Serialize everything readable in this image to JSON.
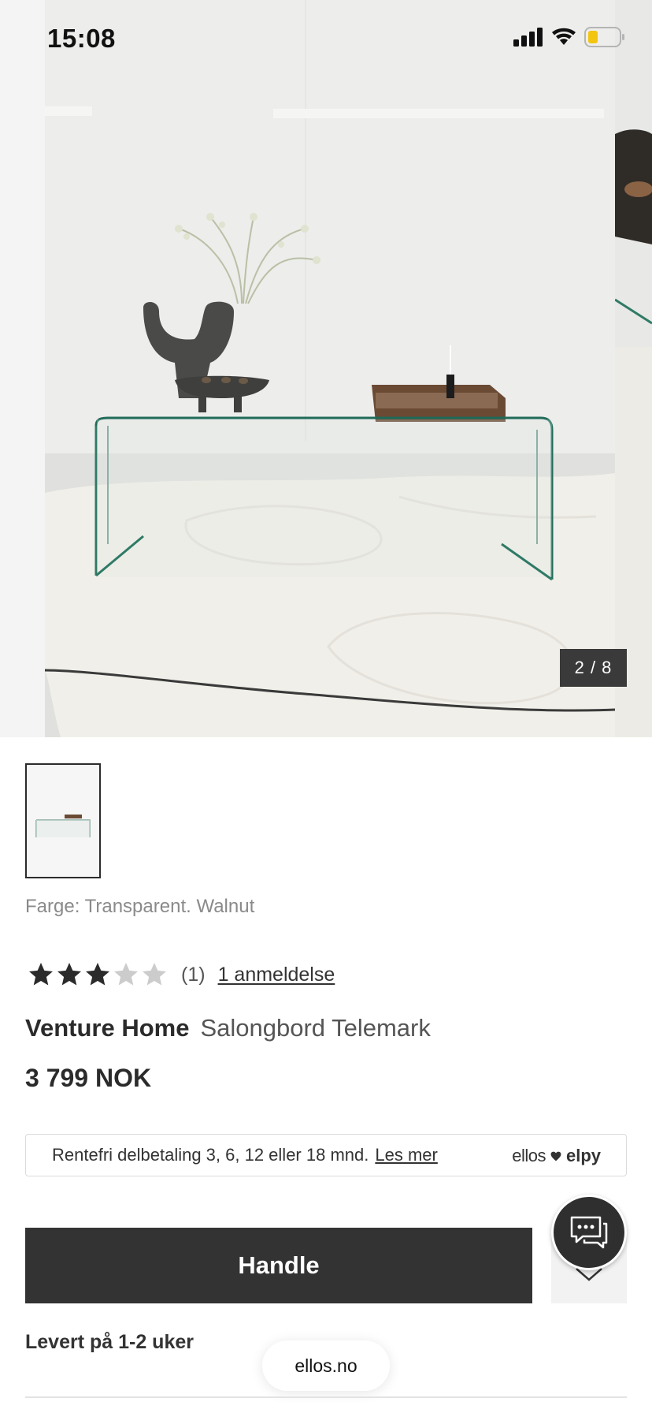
{
  "status_bar": {
    "time": "15:08",
    "icons": [
      "signal-icon",
      "wifi-icon",
      "battery-icon"
    ]
  },
  "gallery": {
    "counter": "2 / 8",
    "thumbnail_alt": "glass-coffee-table-thumbnail"
  },
  "product": {
    "color_line": "Farge: Transparent. Walnut",
    "rating": {
      "stars": 3,
      "max_stars": 5,
      "count": "(1)",
      "reviews_link": "1 anmeldelse"
    },
    "brand": "Venture Home",
    "name": "Salongbord Telemark",
    "price": "3 799 NOK"
  },
  "financing": {
    "text": "Rentefri delbetaling 3, 6, 12 eller 18 mnd.",
    "link": "Les mer",
    "logo_left": "ellos",
    "logo_right": "elpy"
  },
  "actions": {
    "buy_label": "Handle",
    "chat_icon": "chat-bubbles-icon",
    "favorite_icon": "heart-icon"
  },
  "delivery": "Levert på 1-2 uker",
  "browser": {
    "domain": "ellos.no"
  },
  "colors": {
    "primary_button": "#333333",
    "star_filled": "#2b2b2b",
    "star_empty": "#cccccc",
    "counter_bg": "#3a3a3a"
  }
}
